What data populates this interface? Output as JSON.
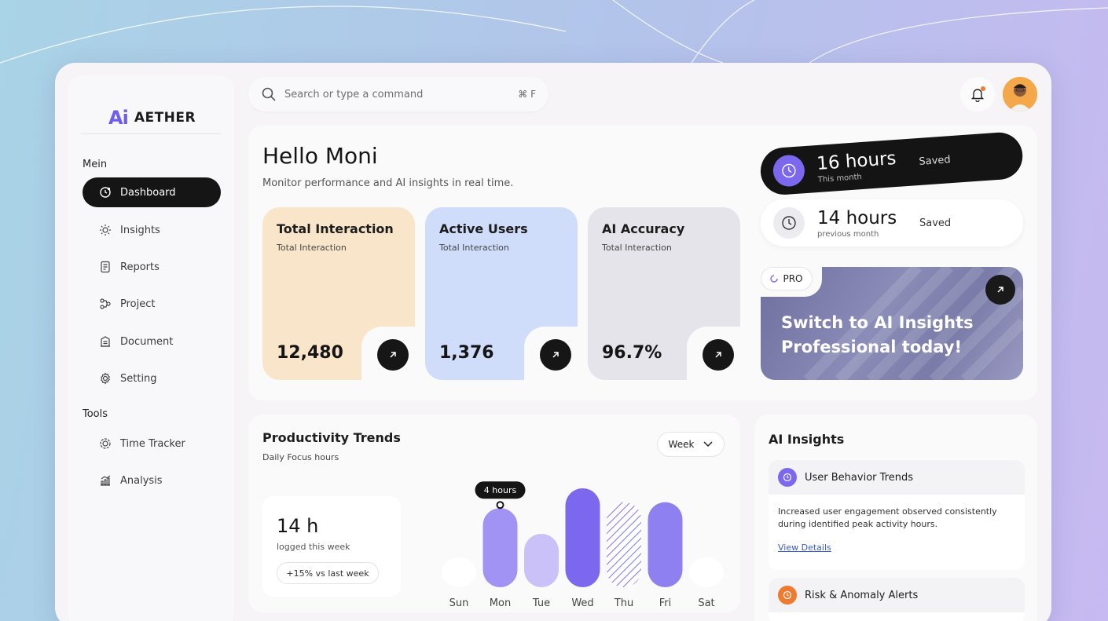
{
  "brand": {
    "logo_mark": "Ai",
    "name": "AETHER"
  },
  "sidebar": {
    "section_main": "Mein",
    "items": [
      {
        "label": "Dashboard",
        "icon": "dashboard-icon",
        "active": true
      },
      {
        "label": "Insights",
        "icon": "sun-icon"
      },
      {
        "label": "Reports",
        "icon": "report-icon"
      },
      {
        "label": "Project",
        "icon": "project-icon"
      },
      {
        "label": "Document",
        "icon": "document-icon"
      },
      {
        "label": "Setting",
        "icon": "gear-icon"
      }
    ],
    "section_tools": "Tools",
    "tools": [
      {
        "label": "Time Tracker",
        "icon": "timer-icon"
      },
      {
        "label": "Analysis",
        "icon": "analysis-icon"
      }
    ]
  },
  "search": {
    "placeholder": "Search or type a command",
    "shortcut": "⌘ F"
  },
  "hero": {
    "greeting": "Hello Moni",
    "subtitle": "Monitor performance and AI insights in real time.",
    "cards": [
      {
        "title": "Total Interaction",
        "sub": "Total Interaction",
        "value": "12,480",
        "color": "#f9e5c9"
      },
      {
        "title": "Active Users",
        "sub": "Total Interaction",
        "value": "1,376",
        "color": "#cfdcfa"
      },
      {
        "title": "AI Accuracy",
        "sub": "Total Interaction",
        "value": "96.7%",
        "color": "#e5e4ea"
      }
    ]
  },
  "hours": {
    "current": {
      "value": "16 hours",
      "sub": "This month",
      "status": "Saved"
    },
    "previous": {
      "value": "14 hours",
      "sub": "previous month",
      "status": "Saved"
    }
  },
  "pro": {
    "badge": "PRO",
    "line1": "Switch to AI Insights",
    "line2": "Professional today!"
  },
  "productivity": {
    "title": "Productivity Trends",
    "subtitle": "Daily Focus hours",
    "range": "Week",
    "logged_value": "14 h",
    "logged_sub": "logged this week",
    "change": "+15% vs last week"
  },
  "chart_data": {
    "type": "bar",
    "categories": [
      "Sun",
      "Mon",
      "Tue",
      "Wed",
      "Thu",
      "Fri",
      "Sat"
    ],
    "values": [
      1.5,
      4,
      2.7,
      5,
      4.3,
      4.3,
      1.5
    ],
    "tooltip": {
      "label": "4 hours",
      "category": "Mon"
    },
    "ylim": [
      0,
      5
    ]
  },
  "ai_insights": {
    "title": "AI Insights",
    "items": [
      {
        "title": "User Behavior Trends",
        "body_line1": "Increased user engagement observed consistently",
        "body_line2": "during identified peak activity hours.",
        "link": "View Details",
        "color": "#7b68ee"
      },
      {
        "title": "Risk & Anomaly Alerts",
        "color": "#f07a2e"
      }
    ]
  }
}
